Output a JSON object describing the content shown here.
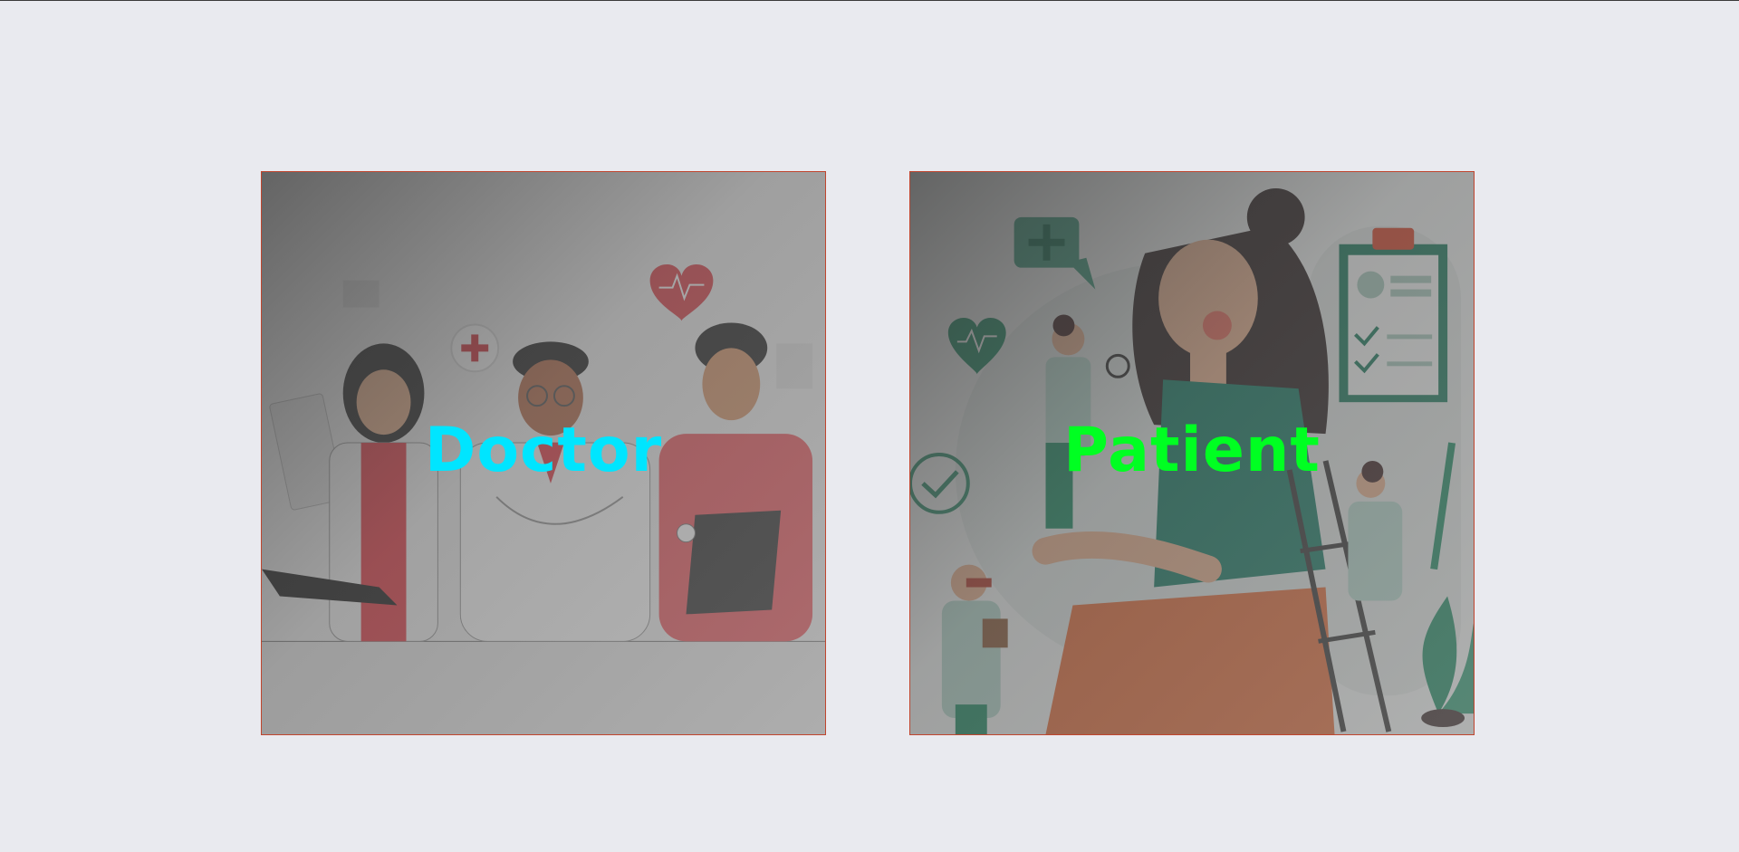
{
  "cards": [
    {
      "label": "Doctor",
      "label_color": "#00e5ff",
      "illustration": "doctors-illustration"
    },
    {
      "label": "Patient",
      "label_color": "#00ff22",
      "illustration": "patient-illustration"
    }
  ],
  "colors": {
    "background": "#e9eaef",
    "card_border": "#c0452e"
  }
}
